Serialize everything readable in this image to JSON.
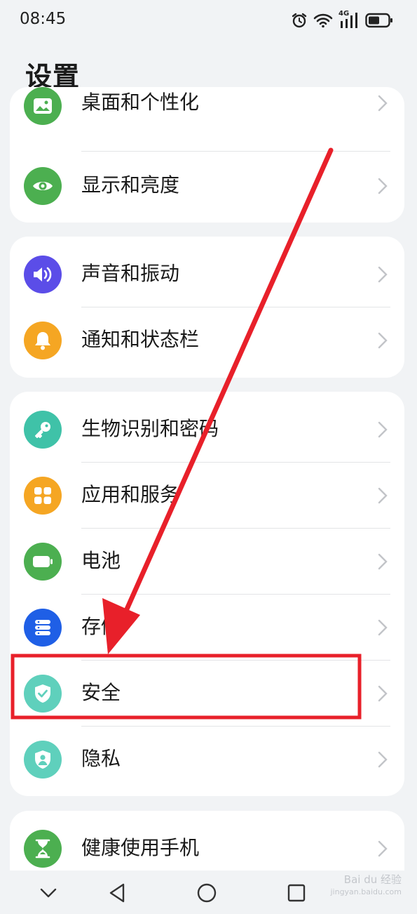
{
  "status_bar": {
    "time": "08:45",
    "network_label": "4G"
  },
  "page": {
    "title": "设置"
  },
  "groups": [
    {
      "items": [
        {
          "label": "桌面和个性化",
          "icon": "image-icon",
          "color": "#4caf50"
        },
        {
          "label": "显示和亮度",
          "icon": "eye-icon",
          "color": "#4caf50"
        }
      ]
    },
    {
      "items": [
        {
          "label": "声音和振动",
          "icon": "speaker-icon",
          "color": "#5b4de8"
        },
        {
          "label": "通知和状态栏",
          "icon": "bell-icon",
          "color": "#f5a623"
        }
      ]
    },
    {
      "items": [
        {
          "label": "生物识别和密码",
          "icon": "key-icon",
          "color": "#3fc2a8"
        },
        {
          "label": "应用和服务",
          "icon": "apps-icon",
          "color": "#f5a623"
        },
        {
          "label": "电池",
          "icon": "battery-icon",
          "color": "#4caf50"
        },
        {
          "label": "存储",
          "icon": "storage-icon",
          "color": "#1f5fe6"
        },
        {
          "label": "安全",
          "icon": "shield-check-icon",
          "color": "#5fd0bc"
        },
        {
          "label": "隐私",
          "icon": "shield-person-icon",
          "color": "#5fd0bc"
        }
      ]
    },
    {
      "items": [
        {
          "label": "健康使用手机",
          "icon": "hourglass-icon",
          "color": "#4caf50"
        }
      ]
    }
  ],
  "annotation": {
    "highlight_color": "#e8202a"
  },
  "watermark": {
    "line1": "Bai du 经验",
    "line2": "jingyan.baidu.com"
  }
}
